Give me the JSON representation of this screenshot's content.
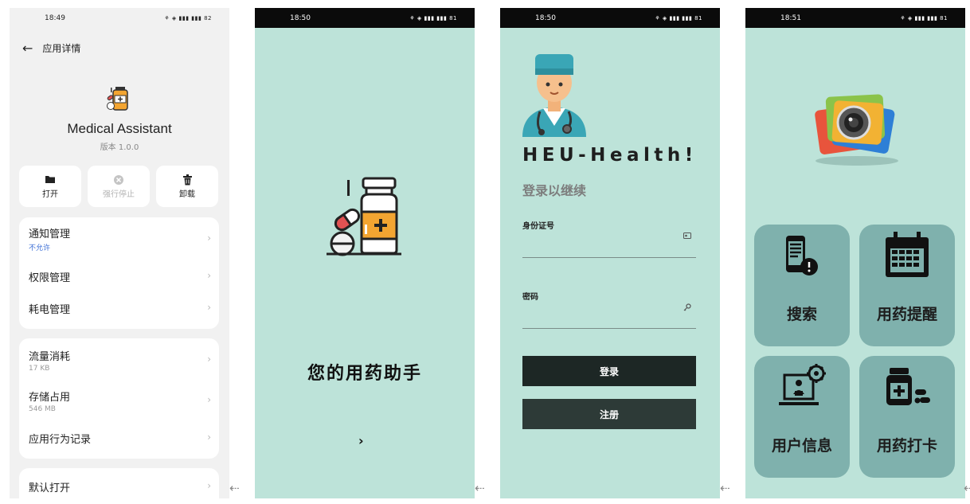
{
  "screen1": {
    "status": {
      "time": "18:49",
      "icons": "⚘ ◈ ▮▮▮ ▮▮▮ 82"
    },
    "header": {
      "back": "←",
      "title": "应用详情"
    },
    "app": {
      "name": "Medical Assistant",
      "version": "版本 1.0.0"
    },
    "actions": [
      {
        "icon": "folder-icon",
        "label": "打开"
      },
      {
        "icon": "stop-icon",
        "label": "强行停止"
      },
      {
        "icon": "trash-icon",
        "label": "卸载"
      }
    ],
    "group1": [
      {
        "title": "通知管理",
        "sub": "不允许"
      },
      {
        "title": "权限管理"
      },
      {
        "title": "耗电管理"
      }
    ],
    "group2": [
      {
        "title": "流量消耗",
        "sub": "17 KB"
      },
      {
        "title": "存储占用",
        "sub": "546 MB"
      },
      {
        "title": "应用行为记录"
      }
    ],
    "group3": [
      {
        "title": "默认打开"
      }
    ]
  },
  "screen2": {
    "status": {
      "time": "18:50",
      "icons": "⚘ ◈ ▮▮▮ ▮▮▮ 81"
    },
    "slogan": "您的用药助手",
    "next": "›"
  },
  "screen3": {
    "status": {
      "time": "18:50",
      "icons": "⚘ ◈ ▮▮▮ ▮▮▮ 81"
    },
    "brand": "HEU-Health!",
    "subtitle": "登录以继续",
    "id_label": "身份证号",
    "password_label": "密码",
    "login": "登录",
    "register": "注册"
  },
  "screen4": {
    "status": {
      "time": "18:51",
      "icons": "⚘ ◈ ▮▮▮ ▮▮▮ 81"
    },
    "tiles": [
      {
        "label": "搜索",
        "icon": "phone-alert-icon"
      },
      {
        "label": "用药提醒",
        "icon": "calendar-icon"
      },
      {
        "label": "用户信息",
        "icon": "laptop-user-icon"
      },
      {
        "label": "用药打卡",
        "icon": "medicine-bottle-icon"
      }
    ]
  },
  "nav_back": "⇠",
  "colors": {
    "teal_bg": "#bde3d9",
    "tile": "#7fb1ad",
    "login_btn": "#1d2725",
    "register_btn": "#2d3a37",
    "settings_bg": "#f1f1f1"
  }
}
